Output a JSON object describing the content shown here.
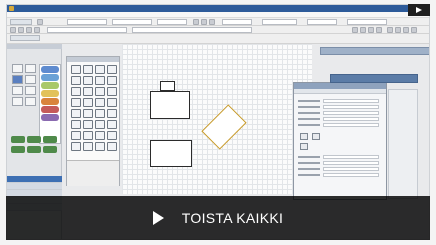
{
  "play_all_label": "TOISTA KAIKKI",
  "colors": {
    "title_bar": "#2d5b9a",
    "overlay": "#000000",
    "selection_outline": "#c79a28",
    "palette_green": "#4f8a4a",
    "layer_selected": "#3d6fb3"
  },
  "icons": {
    "play": "play-icon",
    "playlist_play": "playlist-play-icon"
  }
}
